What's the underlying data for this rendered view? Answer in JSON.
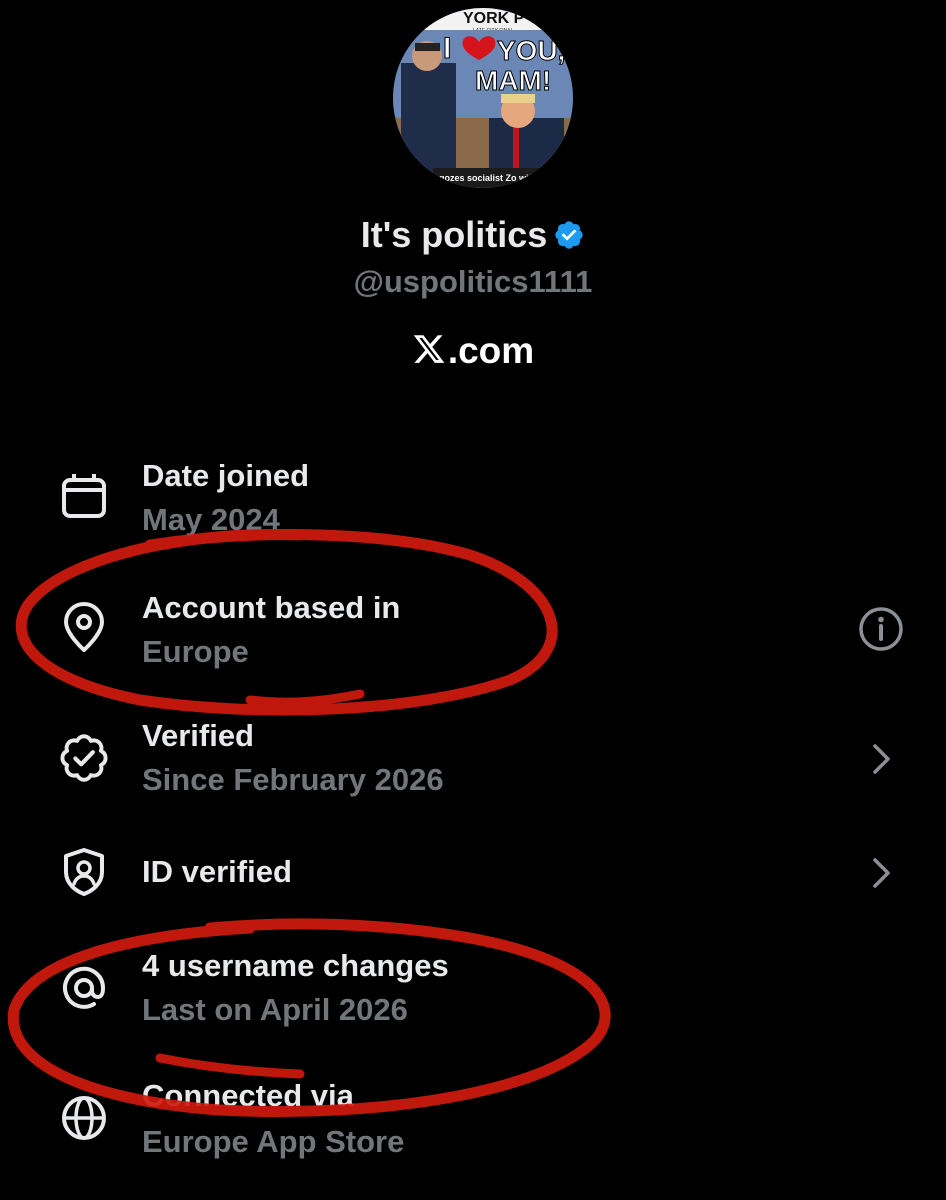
{
  "profile": {
    "avatar_headline_top": "YORK P",
    "avatar_headline_big1": "I",
    "avatar_headline_big2": "YOU,",
    "avatar_headline_big3": "MAM!",
    "avatar_small_text": "LATE CITY FINAL",
    "avatar_caption": "gozes socialist Zo with",
    "display_name": "It's politics",
    "handle": "@uspolitics1111",
    "site": ".com",
    "site_logo": "x-logo"
  },
  "rows": [
    {
      "title": "Date joined",
      "subtitle": "May 2024",
      "icon": "calendar-icon",
      "trailing": ""
    },
    {
      "title": "Account based in",
      "subtitle": "Europe",
      "icon": "location-pin-icon",
      "trailing": "info-icon"
    },
    {
      "title": "Verified",
      "subtitle": "Since February 2026",
      "icon": "verified-badge-icon",
      "trailing": "chevron-right-icon"
    },
    {
      "title": "ID verified",
      "subtitle": "",
      "icon": "id-shield-icon",
      "trailing": "chevron-right-icon"
    },
    {
      "title": "4 username changes",
      "subtitle": "Last on April 2026",
      "icon": "at-sign-icon",
      "trailing": ""
    },
    {
      "title": "Connected via",
      "subtitle": "Europe App Store",
      "icon": "globe-icon",
      "trailing": ""
    }
  ],
  "colors": {
    "background": "#000000",
    "primary_text": "#e7e9ea",
    "secondary_text": "#71767b",
    "verified_blue": "#1d9bf0",
    "annotation_red": "#d11a0f"
  }
}
